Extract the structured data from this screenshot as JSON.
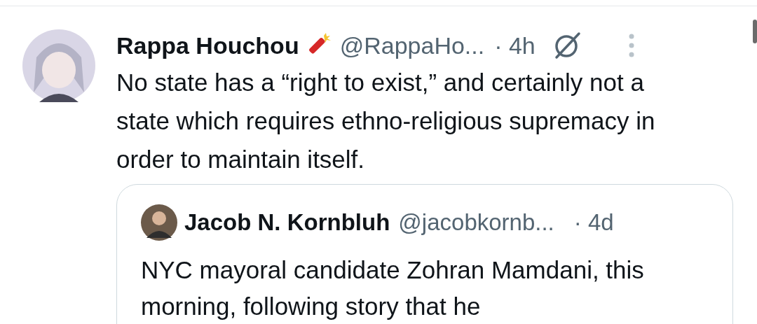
{
  "post": {
    "author": {
      "name": "Rappa Houchou",
      "handle": "@RappaHo...",
      "time": "· 4h"
    },
    "text": "No state has a “right to exist,” and certainly not a state which requires ethno-religious supremacy in order to maintain itself.",
    "quote": {
      "author": {
        "name": "Jacob N. Kornbluh",
        "handle": "@jacobkornb...",
        "time": "· 4d"
      },
      "text": "NYC mayoral candidate Zohran Mamdani, this morning, following story that he"
    }
  }
}
